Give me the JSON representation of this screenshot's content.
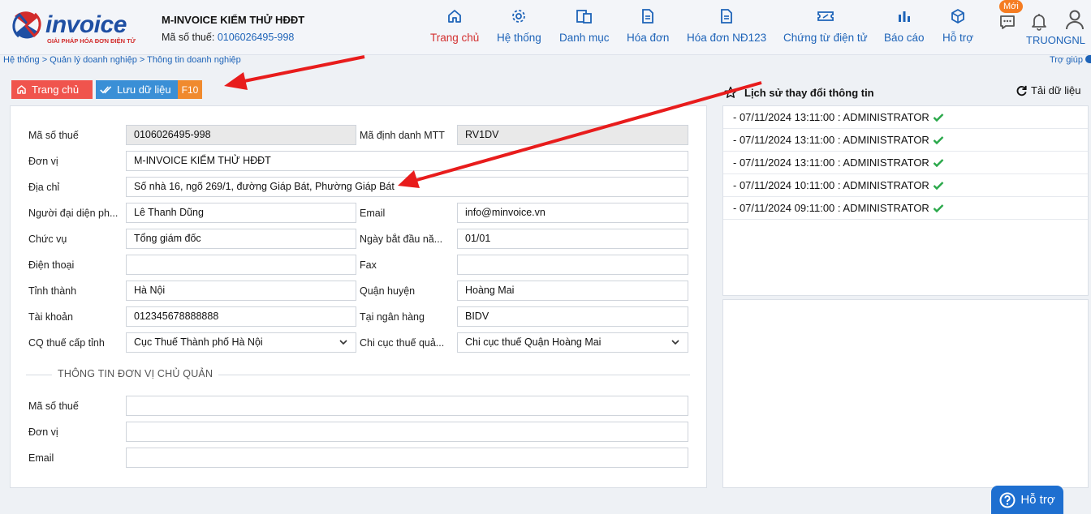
{
  "brand": {
    "logo_text": "invoice",
    "logo_sub": "GIẢI PHÁP HÓA ĐƠN ĐIỆN TỬ"
  },
  "company": {
    "name": "M-INVOICE KIỂM THỬ HĐĐT",
    "tax_label": "Mã số thuế:",
    "tax_value": "0106026495-998"
  },
  "nav": {
    "items": [
      {
        "label": "Trang chủ",
        "icon": "home-icon"
      },
      {
        "label": "Hệ thống",
        "icon": "gear-icon"
      },
      {
        "label": "Danh mục",
        "icon": "catalog-icon"
      },
      {
        "label": "Hóa đơn",
        "icon": "invoice-icon"
      },
      {
        "label": "Hóa đơn NĐ123",
        "icon": "invoice-icon"
      },
      {
        "label": "Chứng từ điện tử",
        "icon": "voucher-icon"
      },
      {
        "label": "Báo cáo",
        "icon": "chart-icon"
      },
      {
        "label": "Hỗ trợ",
        "icon": "cube-icon"
      }
    ],
    "badge": "Mới",
    "username": "TRUONGNL"
  },
  "breadcrumb": "Hệ thống > Quản lý doanh nghiệp > Thông tin doanh nghiệp",
  "help_link": "Trợ giúp",
  "toolbar": {
    "home_label": "Trang chủ",
    "save_label": "Lưu dữ liệu",
    "save_key": "F10"
  },
  "form": {
    "tax_code": {
      "label": "Mã số thuế",
      "value": "0106026495-998"
    },
    "mtt_id": {
      "label": "Mã định danh MTT",
      "value": "RV1DV"
    },
    "unit": {
      "label": "Đơn vị",
      "value": "M-INVOICE KIỂM THỬ HĐĐT"
    },
    "address": {
      "label": "Địa chỉ",
      "value": "Số nhà 16, ngõ 269/1, đường Giáp Bát, Phường Giáp Bát"
    },
    "representative": {
      "label": "Người đại diện ph...",
      "value": "Lê Thanh Dũng"
    },
    "email": {
      "label": "Email",
      "value": "info@minvoice.vn"
    },
    "position": {
      "label": "Chức vụ",
      "value": "Tổng giám đốc"
    },
    "start_date": {
      "label": "Ngày bắt đầu nă...",
      "value": "01/01"
    },
    "phone": {
      "label": "Điện thoại",
      "value": ""
    },
    "fax": {
      "label": "Fax",
      "value": ""
    },
    "province": {
      "label": "Tỉnh thành",
      "value": "Hà Nội"
    },
    "district": {
      "label": "Quận huyện",
      "value": "Hoàng Mai"
    },
    "account": {
      "label": "Tài khoản",
      "value": "012345678888888"
    },
    "bank": {
      "label": "Tại ngân hàng",
      "value": "BIDV"
    },
    "tax_dept": {
      "label": "CQ thuế cấp tỉnh",
      "value": "Cục Thuế Thành phố Hà Nội"
    },
    "tax_branch": {
      "label": "Chi cục thuế quả...",
      "value": "Chi cục thuế Quận Hoàng Mai"
    },
    "section_title": "THÔNG TIN ĐƠN VỊ CHỦ QUẢN",
    "parent_tax_code": {
      "label": "Mã số thuế",
      "value": ""
    },
    "parent_unit": {
      "label": "Đơn vị",
      "value": ""
    },
    "parent_email": {
      "label": "Email",
      "value": ""
    }
  },
  "history": {
    "title": "Lịch sử thay đổi thông tin",
    "reload_label": "Tải dữ liệu",
    "items": [
      "- 07/11/2024 13:11:00 : ADMINISTRATOR",
      "- 07/11/2024 13:11:00 : ADMINISTRATOR",
      "- 07/11/2024 13:11:00 : ADMINISTRATOR",
      "- 07/11/2024 10:11:00 : ADMINISTRATOR",
      "- 07/11/2024 09:11:00 : ADMINISTRATOR"
    ]
  },
  "support_label": "Hỗ trợ",
  "colors": {
    "primary": "#1d63b8",
    "active": "#d32f2f",
    "home_button": "#f0544d",
    "save_button": "#3a8fd6",
    "key_badge": "#f08a2e",
    "annotation_arrow": "#e81c1c",
    "check": "#2aa84a"
  }
}
